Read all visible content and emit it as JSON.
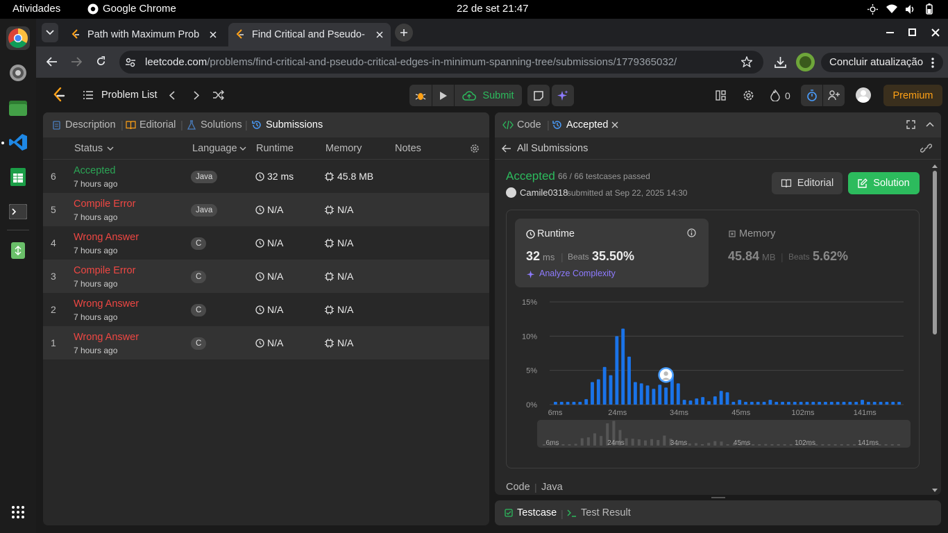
{
  "os": {
    "activities": "Atividades",
    "app_name": "Google Chrome",
    "clock": "22 de set  21:47"
  },
  "browser": {
    "tabs": [
      {
        "title": "Path with Maximum Prob"
      },
      {
        "title": "Find Critical and Pseudo-"
      }
    ],
    "url_host": "leetcode.com",
    "url_path": "/problems/find-critical-and-pseudo-critical-edges-in-minimum-spanning-tree/submissions/1779365032/",
    "update_label": "Concluir atualização"
  },
  "leetcode": {
    "problem_list": "Problem List",
    "submit": "Submit",
    "streak": "0",
    "premium": "Premium"
  },
  "left_panel": {
    "tabs": [
      "Description",
      "Editorial",
      "Solutions",
      "Submissions"
    ],
    "columns": {
      "status": "Status",
      "language": "Language",
      "runtime": "Runtime",
      "memory": "Memory",
      "notes": "Notes"
    },
    "rows": [
      {
        "num": "6",
        "status": "Accepted",
        "ago": "7 hours ago",
        "lang": "Java",
        "runtime": "32 ms",
        "memory": "45.8 MB"
      },
      {
        "num": "5",
        "status": "Compile Error",
        "ago": "7 hours ago",
        "lang": "Java",
        "runtime": "N/A",
        "memory": "N/A"
      },
      {
        "num": "4",
        "status": "Wrong Answer",
        "ago": "7 hours ago",
        "lang": "C",
        "runtime": "N/A",
        "memory": "N/A"
      },
      {
        "num": "3",
        "status": "Compile Error",
        "ago": "7 hours ago",
        "lang": "C",
        "runtime": "N/A",
        "memory": "N/A"
      },
      {
        "num": "2",
        "status": "Wrong Answer",
        "ago": "7 hours ago",
        "lang": "C",
        "runtime": "N/A",
        "memory": "N/A"
      },
      {
        "num": "1",
        "status": "Wrong Answer",
        "ago": "7 hours ago",
        "lang": "C",
        "runtime": "N/A",
        "memory": "N/A"
      }
    ]
  },
  "right_panel": {
    "tab_code": "Code",
    "tab_accepted": "Accepted",
    "all_submissions": "All Submissions",
    "result": "Accepted",
    "testcases": "66 / 66 testcases passed",
    "user": "Camile0318",
    "submitted_at": "submitted at Sep 22, 2025 14:30",
    "editorial_btn": "Editorial",
    "solution_btn": "Solution",
    "runtime_label": "Runtime",
    "runtime_value": "32",
    "runtime_unit": "ms",
    "beats_label": "Beats",
    "runtime_beats": "35.50%",
    "analyze": "Analyze Complexity",
    "memory_label": "Memory",
    "memory_value": "45.84",
    "memory_unit": "MB",
    "memory_beats": "5.62%",
    "code_label": "Code",
    "code_lang": "Java"
  },
  "bottom_panel": {
    "testcase": "Testcase",
    "test_result": "Test Result"
  },
  "chart_data": {
    "type": "bar",
    "ylim": [
      0,
      15
    ],
    "yticks": [
      "15%",
      "10%",
      "5%",
      "0%"
    ],
    "xticks": [
      "6ms",
      "24ms",
      "34ms",
      "45ms",
      "102ms",
      "141ms"
    ],
    "values": [
      0.4,
      0.4,
      0.4,
      0.4,
      0.4,
      0.8,
      3.3,
      3.7,
      5.5,
      4.3,
      10,
      11.1,
      7,
      3.3,
      3.1,
      2.8,
      2.3,
      2.9,
      2.5,
      4.5,
      3.1,
      0.7,
      0.6,
      0.9,
      1.1,
      0.5,
      1.2,
      2,
      1.8,
      0.4,
      0.7,
      0.4,
      0.4,
      0.4,
      0.4,
      0.7,
      0.4,
      0.4,
      0.4,
      0.4,
      0.4,
      0.4,
      0.4,
      0.4,
      0.4,
      0.4,
      0.4,
      0.4,
      0.4,
      0.4,
      0.7,
      0.4,
      0.4,
      0.4,
      0.4,
      0.4,
      0.4
    ],
    "highlight_index": 18
  },
  "colors": {
    "green": "#2cbb5d",
    "red": "#ef4743",
    "bar": "#1a73e8",
    "premium": "#ffa116"
  }
}
